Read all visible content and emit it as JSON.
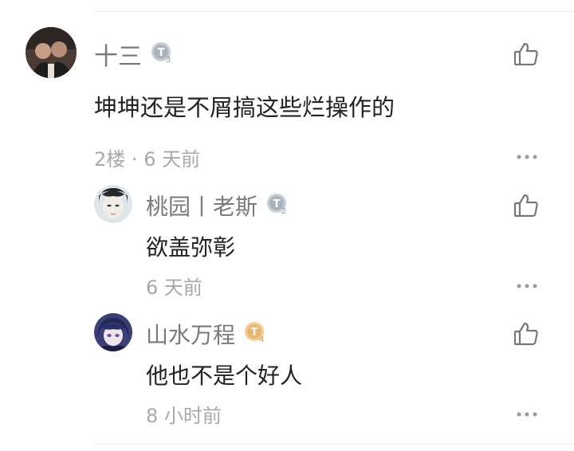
{
  "colors": {
    "name": "#7a7a7a",
    "content": "#222222",
    "meta": "#a8a8a8",
    "icon": "#777777",
    "badge_silver": "#aab3bd",
    "badge_gold": "#e9b76c"
  },
  "comment": {
    "author": "十三",
    "level_badge": "T3",
    "text": "坤坤还是不屑搞这些烂操作的",
    "floor": "2楼",
    "separator": "·",
    "time": "6 天前",
    "like_icon": "thumbs-up-icon",
    "more_icon": "more-dots-icon"
  },
  "replies": [
    {
      "author": "桃园丨老斯",
      "level_badge": "T2",
      "text": "欲盖弥彰",
      "time": "6 天前",
      "like_icon": "thumbs-up-icon",
      "more_icon": "more-dots-icon"
    },
    {
      "author": "山水万程",
      "level_badge": "T4",
      "text": "他也不是个好人",
      "time": "8 小时前",
      "like_icon": "thumbs-up-icon",
      "more_icon": "more-dots-icon"
    }
  ]
}
